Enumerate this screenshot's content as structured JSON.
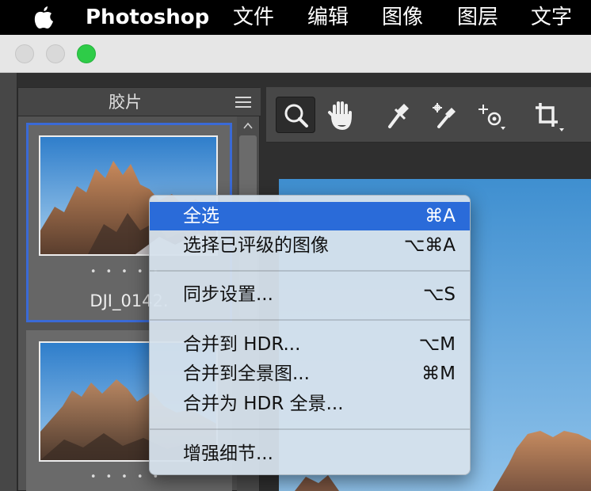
{
  "menubar": {
    "app": "Photoshop",
    "items": [
      "文件",
      "编辑",
      "图像",
      "图层",
      "文字"
    ]
  },
  "filmstrip": {
    "title": "胶片",
    "thumbnails": [
      {
        "filename": "DJI_0142.",
        "rating_dots": "•••••",
        "selected": true
      },
      {
        "filename": "",
        "rating_dots": "•••••",
        "selected": false
      }
    ]
  },
  "toolbar": {
    "tools": [
      "zoom-tool-icon",
      "hand-tool-icon",
      "white-balance-eyedropper-icon",
      "color-sampler-icon",
      "targeted-adjustment-icon",
      "crop-tool-icon"
    ]
  },
  "context_menu": {
    "items": [
      {
        "label": "全选",
        "shortcut": "⌘A",
        "highlighted": true
      },
      {
        "label": "选择已评级的图像",
        "shortcut": "⌥⌘A"
      },
      {
        "label": "同步设置...",
        "shortcut": "⌥S"
      },
      {
        "label": "合并到 HDR...",
        "shortcut": "⌥M"
      },
      {
        "label": "合并到全景图...",
        "shortcut": "⌘M"
      },
      {
        "label": "合并为 HDR 全景...",
        "shortcut": ""
      },
      {
        "label": "增强细节...",
        "shortcut": ""
      }
    ]
  },
  "colors": {
    "menubar_bg": "#000000",
    "highlight": "#2a6bd9",
    "selection_border": "#3a6ad6",
    "zoom_light": "#2ecc48",
    "sky": "#3f8fd0"
  }
}
